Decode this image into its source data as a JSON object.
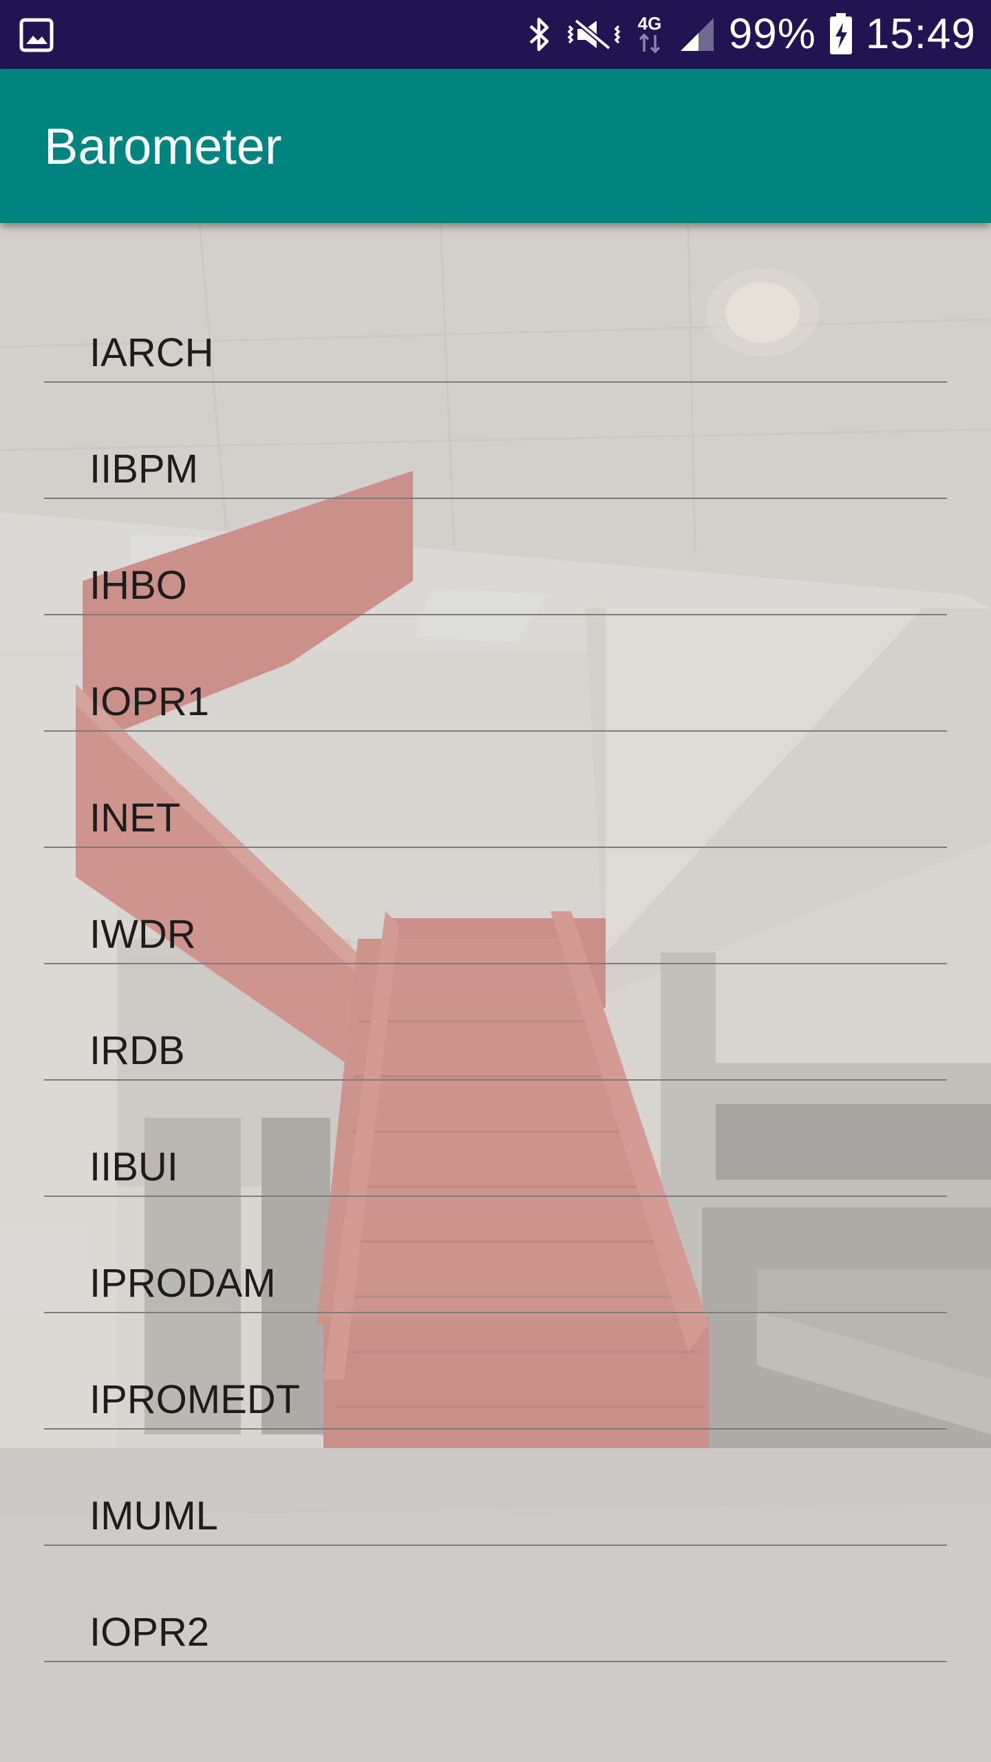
{
  "status_bar": {
    "battery": "99%",
    "time": "15:49",
    "network": "4G",
    "icons": [
      "image-notification-icon",
      "bluetooth-icon",
      "vibrate-icon",
      "signal-icon",
      "battery-charging-icon"
    ]
  },
  "app_bar": {
    "title": "Barometer",
    "color": "#00847f"
  },
  "list": {
    "items": [
      {
        "label": "IARCH"
      },
      {
        "label": "IIBPM"
      },
      {
        "label": "IHBO"
      },
      {
        "label": "IOPR1"
      },
      {
        "label": "INET"
      },
      {
        "label": "IWDR"
      },
      {
        "label": "IRDB"
      },
      {
        "label": "IIBUI"
      },
      {
        "label": "IPRODAM"
      },
      {
        "label": "IPROMEDT"
      },
      {
        "label": "IMUML"
      },
      {
        "label": "IOPR2"
      }
    ]
  }
}
